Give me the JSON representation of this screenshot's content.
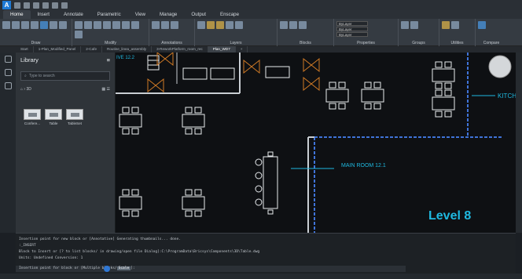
{
  "ribbon": {
    "tabs": [
      "Home",
      "Insert",
      "Annotate",
      "Parametric",
      "View",
      "Manage",
      "Output",
      "Enscape"
    ],
    "active_tab": "Home",
    "panels": [
      "Draw",
      "Modify",
      "Annotations",
      "Layers",
      "Blocks",
      "Properties",
      "Groups",
      "Utilities",
      "Compare"
    ],
    "prop_fields": [
      "ByLayer",
      "ByLayer",
      "ByLayer"
    ]
  },
  "doc_tabs": [
    "Start",
    "1-Plan_Modified_Panel",
    "2-Cafe",
    "Routine_linea_assembly",
    "3-ReworkPlatform_room_rec",
    "Plan_WD7",
    "+"
  ],
  "doc_tab_active": 5,
  "library": {
    "title": "Library",
    "search_placeholder": "Type to search",
    "breadcrumb": "3D",
    "items": [
      "Confere...",
      "Table",
      "TableSet"
    ]
  },
  "drawing": {
    "label_top": "IVE 12.2",
    "label_main_room": "MAIN ROOM 12.1",
    "label_kitchen": "KITCH",
    "label_level": "Level 8"
  },
  "command": {
    "lines": [
      "Insertion point for new block or [Annotative] Generating thumbnails... done.",
      ":_INSERT",
      "Block to Insert or [? to list blocks/ in drawing/open file Dialog]:C:\\ProgramData\\Bricsys\\Components\\3D\\Table.dwg",
      "Units: Undefined    Conversion: 1"
    ],
    "prompt": "Insertion point for block or [Multiple blocks/",
    "prompt_highlight": "Scale",
    "prompt_end": "]:"
  },
  "colors": {
    "accent": "#1e7ad6",
    "label_cyan": "#1fb9e0",
    "wall": "#c9ced3",
    "furniture": "#e8ebee",
    "dashed_blue": "#3f73d8",
    "orange": "#d07a25"
  }
}
